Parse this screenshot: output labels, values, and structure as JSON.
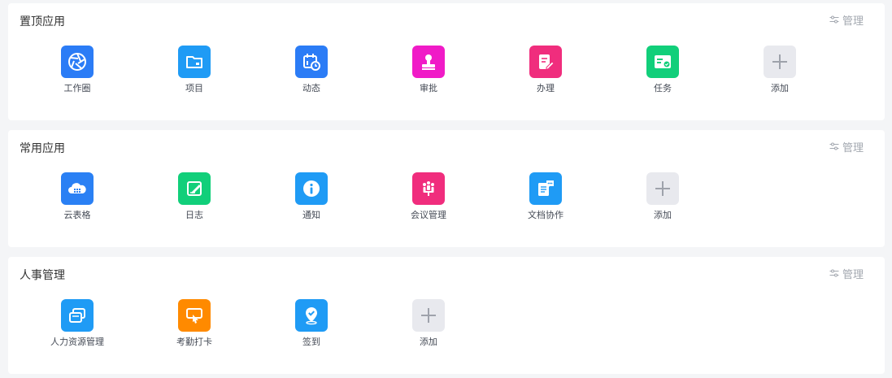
{
  "sections": [
    {
      "title": "置顶应用",
      "manage_label": "管理",
      "apps": [
        {
          "label": "工作圈",
          "icon": "aperture-icon",
          "color": "#2b7cf6"
        },
        {
          "label": "项目",
          "icon": "folder-icon",
          "color": "#1f9bf5"
        },
        {
          "label": "动态",
          "icon": "calendar-clock-icon",
          "color": "#2b7cf6"
        },
        {
          "label": "审批",
          "icon": "stamp-icon",
          "color": "#f01bc7"
        },
        {
          "label": "办理",
          "icon": "edit-document-icon",
          "color": "#f02d7d"
        },
        {
          "label": "任务",
          "icon": "task-card-icon",
          "color": "#11cf7a"
        },
        {
          "label": "添加",
          "icon": "plus-icon",
          "color": "#e8e9ee"
        }
      ]
    },
    {
      "title": "常用应用",
      "manage_label": "管理",
      "apps": [
        {
          "label": "云表格",
          "icon": "cloud-table-icon",
          "color": "#2a80f4"
        },
        {
          "label": "日志",
          "icon": "note-pen-icon",
          "color": "#11cf7a"
        },
        {
          "label": "通知",
          "icon": "info-icon",
          "color": "#1f9bf5"
        },
        {
          "label": "会议管理",
          "icon": "meeting-icon",
          "color": "#f02d7d"
        },
        {
          "label": "文档协作",
          "icon": "document-chat-icon",
          "color": "#1f9bf5"
        },
        {
          "label": "添加",
          "icon": "plus-icon",
          "color": "#e8e9ee"
        }
      ]
    },
    {
      "title": "人事管理",
      "manage_label": "管理",
      "apps": [
        {
          "label": "人力资源管理",
          "icon": "cards-icon",
          "color": "#1f9bf5"
        },
        {
          "label": "考勤打卡",
          "icon": "clock-in-icon",
          "color": "#ff8a00"
        },
        {
          "label": "签到",
          "icon": "location-check-icon",
          "color": "#1f9bf5"
        },
        {
          "label": "添加",
          "icon": "plus-icon",
          "color": "#e8e9ee"
        }
      ]
    }
  ]
}
